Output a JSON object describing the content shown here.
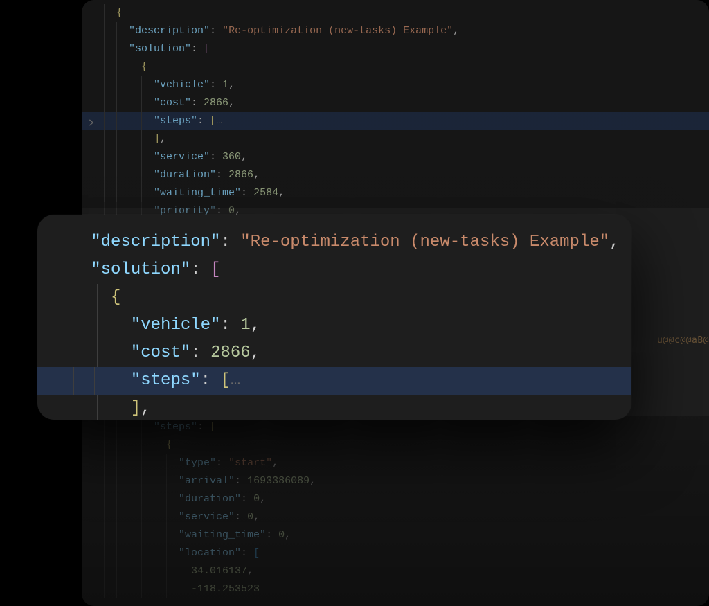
{
  "back": {
    "lines": [
      {
        "indent": 1,
        "tokens": [
          [
            "brace",
            "{"
          ]
        ]
      },
      {
        "indent": 2,
        "tokens": [
          [
            "key",
            "\"description\""
          ],
          [
            "punct",
            ": "
          ],
          [
            "str",
            "\"Re-optimization (new-tasks) Example\""
          ],
          [
            "punct",
            ","
          ]
        ]
      },
      {
        "indent": 2,
        "tokens": [
          [
            "key",
            "\"solution\""
          ],
          [
            "punct",
            ": "
          ],
          [
            "brack",
            "["
          ]
        ]
      },
      {
        "indent": 3,
        "tokens": [
          [
            "brace",
            "{"
          ]
        ]
      },
      {
        "indent": 4,
        "tokens": [
          [
            "key",
            "\"vehicle\""
          ],
          [
            "punct",
            ": "
          ],
          [
            "num",
            "1"
          ],
          [
            "punct",
            ","
          ]
        ]
      },
      {
        "indent": 4,
        "tokens": [
          [
            "key",
            "\"cost\""
          ],
          [
            "punct",
            ": "
          ],
          [
            "num",
            "2866"
          ],
          [
            "punct",
            ","
          ]
        ]
      },
      {
        "indent": 4,
        "hl": true,
        "chevron": true,
        "tokens": [
          [
            "key",
            "\"steps\""
          ],
          [
            "punct",
            ": "
          ],
          [
            "brack3",
            "["
          ],
          [
            "fold",
            "…"
          ]
        ]
      },
      {
        "indent": 4,
        "tokens": [
          [
            "brack3",
            "]"
          ],
          [
            "punct",
            ","
          ]
        ]
      },
      {
        "indent": 4,
        "tokens": [
          [
            "key",
            "\"service\""
          ],
          [
            "punct",
            ": "
          ],
          [
            "num",
            "360"
          ],
          [
            "punct",
            ","
          ]
        ]
      },
      {
        "indent": 4,
        "tokens": [
          [
            "key",
            "\"duration\""
          ],
          [
            "punct",
            ": "
          ],
          [
            "num",
            "2866"
          ],
          [
            "punct",
            ","
          ]
        ]
      },
      {
        "indent": 4,
        "tokens": [
          [
            "key",
            "\"waiting_time\""
          ],
          [
            "punct",
            ": "
          ],
          [
            "num",
            "2584"
          ],
          [
            "punct",
            ","
          ]
        ]
      },
      {
        "indent": 4,
        "dim": true,
        "tokens": [
          [
            "key",
            "\"priority\""
          ],
          [
            "punct",
            ": "
          ],
          [
            "num",
            "0"
          ],
          [
            "punct",
            ","
          ]
        ]
      },
      {
        "spacer": true
      },
      {
        "spacer": true
      },
      {
        "spacer": true
      },
      {
        "spacer": true
      },
      {
        "spacer": true
      },
      {
        "spacer": true
      },
      {
        "spacer": true
      },
      {
        "spacer": true
      },
      {
        "spacer": true
      },
      {
        "spacer": true
      },
      {
        "spacer": true
      },
      {
        "indent": 4,
        "dim": true,
        "tokens": [
          [
            "key",
            "\"steps\""
          ],
          [
            "punct",
            ": "
          ],
          [
            "brack3",
            "["
          ]
        ]
      },
      {
        "indent": 5,
        "dim": true,
        "tokens": [
          [
            "brace",
            "{"
          ]
        ]
      },
      {
        "indent": 6,
        "dim": true,
        "tokens": [
          [
            "key",
            "\"type\""
          ],
          [
            "punct",
            ": "
          ],
          [
            "str",
            "\"start\""
          ],
          [
            "punct",
            ","
          ]
        ]
      },
      {
        "indent": 6,
        "dim": true,
        "tokens": [
          [
            "key",
            "\"arrival\""
          ],
          [
            "punct",
            ": "
          ],
          [
            "num",
            "1693386089"
          ],
          [
            "punct",
            ","
          ]
        ]
      },
      {
        "indent": 6,
        "dim": true,
        "tokens": [
          [
            "key",
            "\"duration\""
          ],
          [
            "punct",
            ": "
          ],
          [
            "num",
            "0"
          ],
          [
            "punct",
            ","
          ]
        ]
      },
      {
        "indent": 6,
        "dim": true,
        "tokens": [
          [
            "key",
            "\"service\""
          ],
          [
            "punct",
            ": "
          ],
          [
            "num",
            "0"
          ],
          [
            "punct",
            ","
          ]
        ]
      },
      {
        "indent": 6,
        "dim": true,
        "tokens": [
          [
            "key",
            "\"waiting_time\""
          ],
          [
            "punct",
            ": "
          ],
          [
            "num",
            "0"
          ],
          [
            "punct",
            ","
          ]
        ]
      },
      {
        "indent": 6,
        "dim": true,
        "tokens": [
          [
            "key",
            "\"location\""
          ],
          [
            "punct",
            ": "
          ],
          [
            "brack2",
            "["
          ]
        ]
      },
      {
        "indent": 7,
        "dim": true,
        "tokens": [
          [
            "num",
            "34.016137"
          ],
          [
            "punct",
            ","
          ]
        ]
      },
      {
        "indent": 7,
        "dim": true,
        "tokens": [
          [
            "num",
            "-118.253523"
          ]
        ]
      }
    ]
  },
  "front": {
    "lines": [
      {
        "indent": 0,
        "tokens": [
          [
            "key",
            "\"description\""
          ],
          [
            "punct",
            ": "
          ],
          [
            "str",
            "\"Re-optimization (new-tasks) Example\""
          ],
          [
            "punct",
            ","
          ]
        ]
      },
      {
        "indent": 0,
        "tokens": [
          [
            "key",
            "\"solution\""
          ],
          [
            "punct",
            ": "
          ],
          [
            "brack",
            "["
          ]
        ]
      },
      {
        "indent": 1,
        "tokens": [
          [
            "brace",
            "{"
          ]
        ]
      },
      {
        "indent": 2,
        "tokens": [
          [
            "key",
            "\"vehicle\""
          ],
          [
            "punct",
            ": "
          ],
          [
            "num",
            "1"
          ],
          [
            "punct",
            ","
          ]
        ]
      },
      {
        "indent": 2,
        "tokens": [
          [
            "key",
            "\"cost\""
          ],
          [
            "punct",
            ": "
          ],
          [
            "num",
            "2866"
          ],
          [
            "punct",
            ","
          ]
        ]
      },
      {
        "indent": 2,
        "hl": true,
        "tokens": [
          [
            "key",
            "\"steps\""
          ],
          [
            "punct",
            ": "
          ],
          [
            "brack3",
            "["
          ],
          [
            "fold",
            "…"
          ]
        ]
      },
      {
        "indent": 2,
        "tokens": [
          [
            "brack3",
            "]"
          ],
          [
            "punct",
            ","
          ]
        ]
      }
    ]
  },
  "edge_text": "u@@c@@aB@"
}
